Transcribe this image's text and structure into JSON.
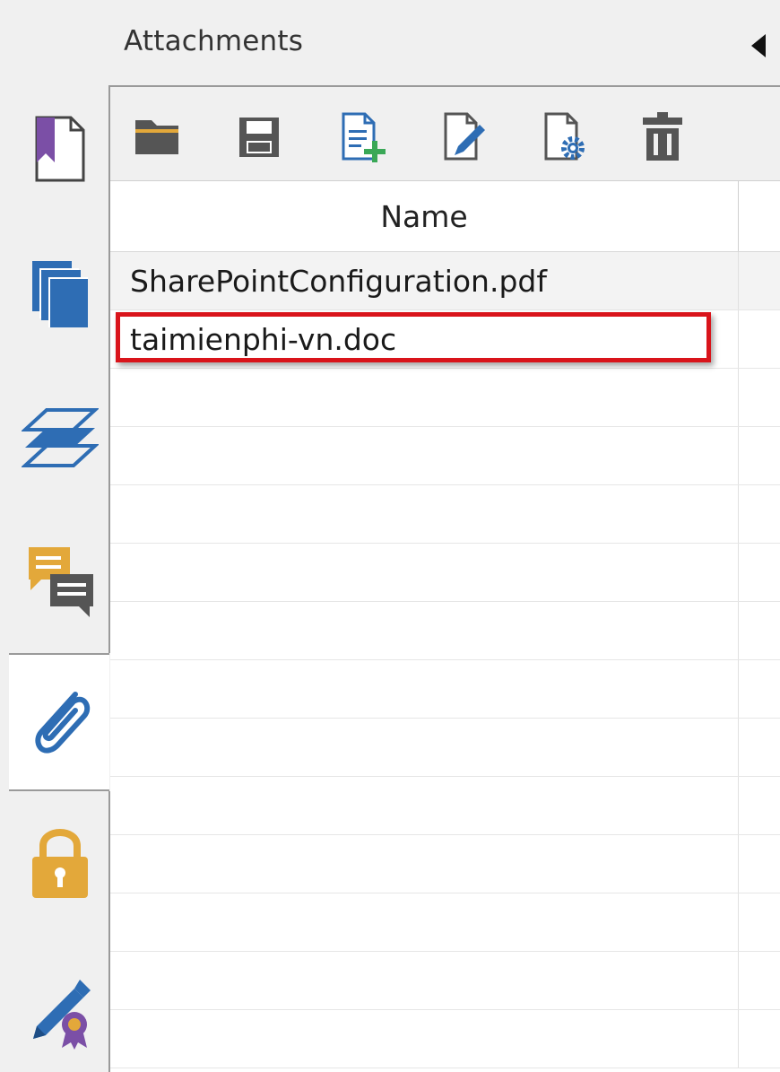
{
  "panel": {
    "title": "Attachments",
    "collapse_icon": "triangle-left-icon"
  },
  "rail": {
    "items": [
      {
        "icon": "bookmark-icon",
        "color": "#7b4fa6"
      },
      {
        "icon": "pages-icon",
        "color": "#2e6db4"
      },
      {
        "icon": "layers-icon",
        "color": "#2e6db4"
      },
      {
        "icon": "comments-icon",
        "color": "#e3a83a"
      },
      {
        "icon": "paperclip-icon",
        "color": "#2e6db4",
        "active": true
      },
      {
        "icon": "lock-icon",
        "color": "#e3a83a"
      },
      {
        "icon": "signature-icon",
        "color": "#2e6db4"
      }
    ]
  },
  "toolbar": {
    "buttons": [
      {
        "icon": "open-folder-icon"
      },
      {
        "icon": "save-icon"
      },
      {
        "icon": "add-file-icon"
      },
      {
        "icon": "edit-file-icon"
      },
      {
        "icon": "file-settings-icon"
      },
      {
        "icon": "delete-icon"
      }
    ]
  },
  "table": {
    "columns": [
      "Name"
    ],
    "rows": [
      {
        "name": "SharePointConfiguration.pdf",
        "highlighted": false
      },
      {
        "name": "taimienphi-vn.doc",
        "highlighted": true
      }
    ],
    "highlight_color": "#d9141b"
  }
}
